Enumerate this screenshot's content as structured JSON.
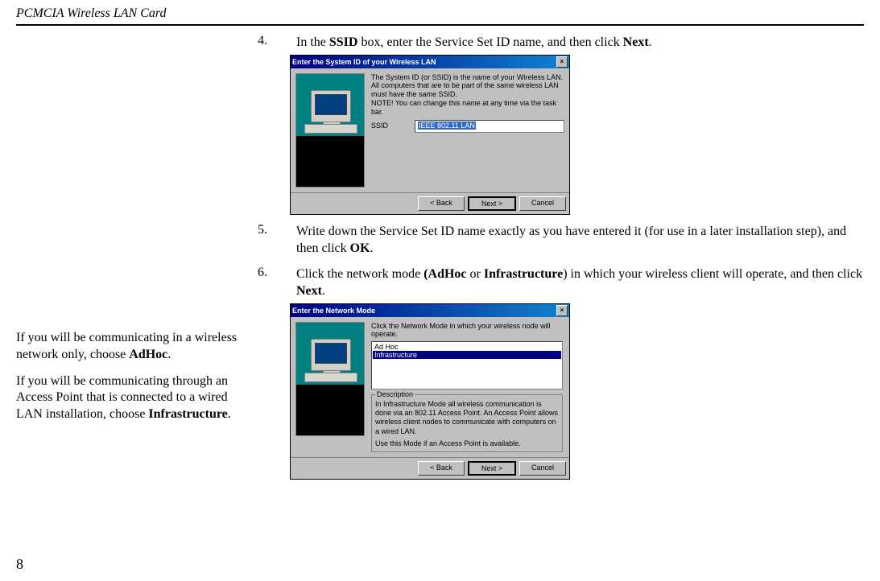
{
  "header": {
    "title": "PCMCIA Wireless LAN Card"
  },
  "steps": {
    "s4": {
      "num": "4.",
      "before": "In the ",
      "b1": "SSID",
      "mid": " box, enter the Service Set ID name, and then click ",
      "b2": "Next",
      "after": "."
    },
    "s5": {
      "num": "5.",
      "before": "Write down the Service Set ID name exactly as you have entered it (for use in a later installation step), and then click ",
      "b1": "OK",
      "after": "."
    },
    "s6": {
      "num": "6.",
      "before": "Click the network mode ",
      "b1": "(AdHoc",
      "mid": " or ",
      "b2": "Infrastructure",
      "mid2": ") in which your wireless client will operate, and then click ",
      "b3": "Next",
      "after": "."
    }
  },
  "sidebar": {
    "p1a": "If you will be communicating in a wireless network only, choose ",
    "p1b": "AdHoc",
    "p1c": ".",
    "p2a": "If you will be communicating through an Access Point that is connected to a wired LAN installation, choose ",
    "p2b": "Infrastructure",
    "p2c": "."
  },
  "dialog1": {
    "title": "Enter the System ID of your Wireless LAN",
    "body": "The System ID (or SSID) is the name of your Wireless LAN. All computers that are to be part of the same wireless LAN must have the same SSID.\nNOTE! You can change this name at any time via the task bar.",
    "ssid_label": "SSID",
    "ssid_value": "IEEE 802.11 LAN",
    "back": "< Back",
    "next": "Next >",
    "cancel": "Cancel"
  },
  "dialog2": {
    "title": "Enter the Network Mode",
    "body": "Click the Network Mode in which your wireless node will operate.",
    "opt1": "Ad Hoc",
    "opt2": "Infrastructure",
    "desc_label": "Description",
    "desc_text": "In Infrastructure Mode all wireless communication is done via an 802.11 Access Point. An Access Point allows wireless client nodes to communicate with computers on a wired LAN.",
    "desc_text2": "Use this Mode if an Access Point is available.",
    "back": "< Back",
    "next": "Next >",
    "cancel": "Cancel"
  },
  "page_number": "8"
}
